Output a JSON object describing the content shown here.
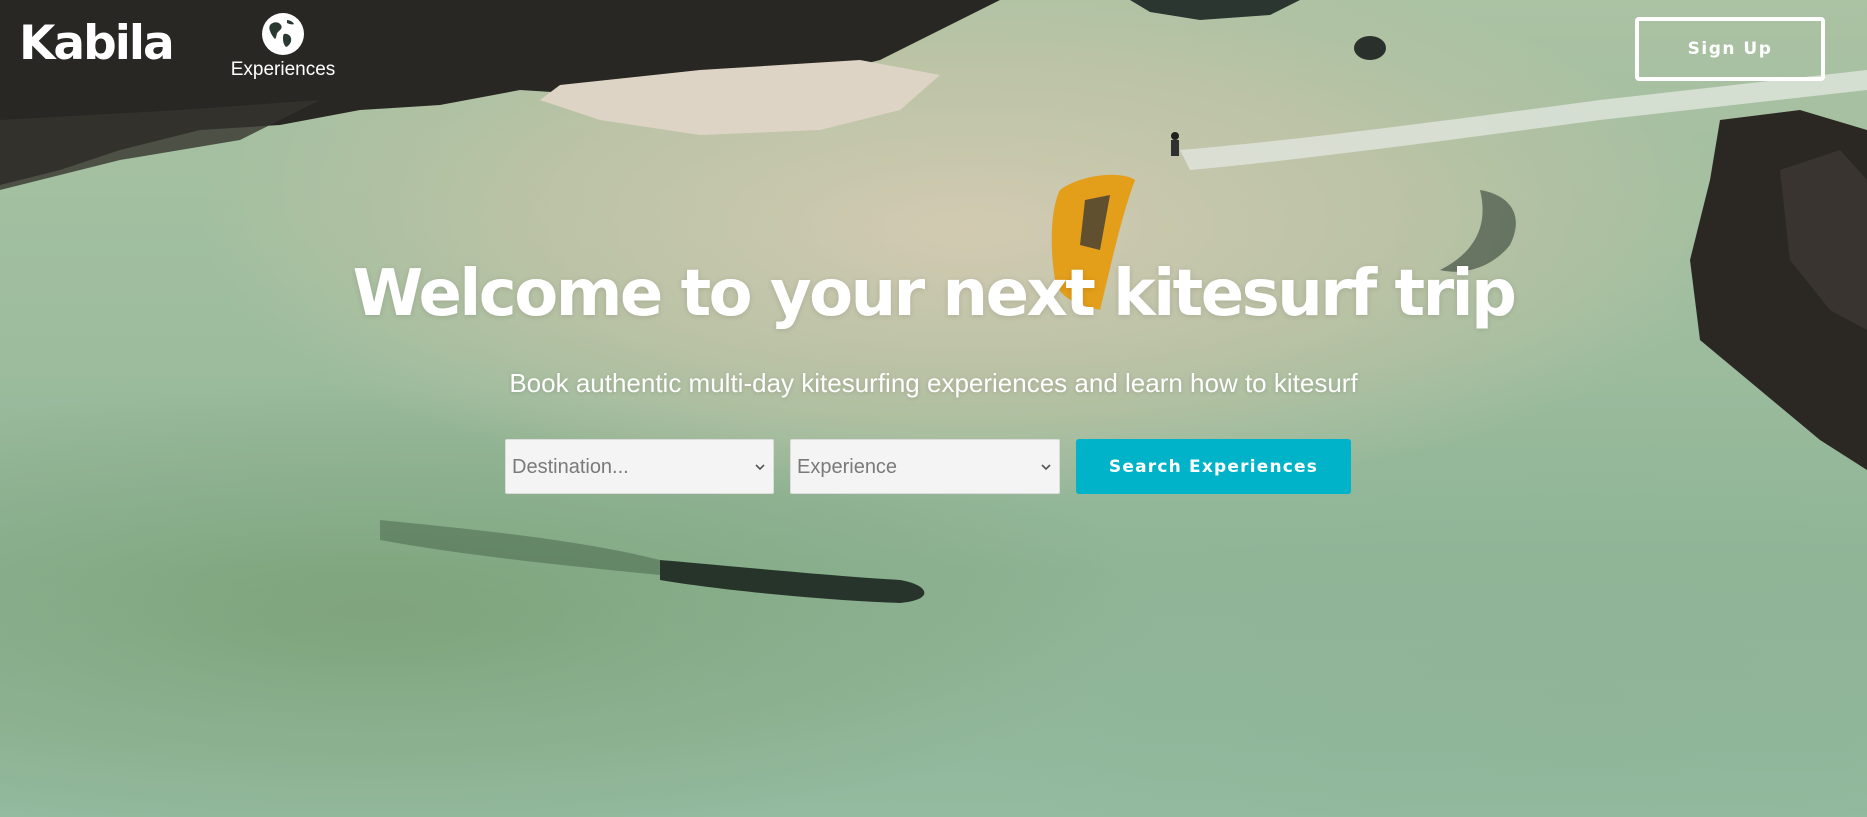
{
  "header": {
    "logo_text": "Kabila",
    "nav_experiences_label": "Experiences",
    "nav_experiences_icon": "globe-icon",
    "signup_label": "Sign Up"
  },
  "hero": {
    "headline": "Welcome to your next kitesurf trip",
    "subheadline": "Book authentic multi-day kitesurfing experiences and learn how to kitesurf"
  },
  "search": {
    "destination_value": "Destination...",
    "experience_value": "Experience",
    "submit_label": "Search Experiences"
  },
  "colors": {
    "accent": "#00b3c9",
    "text_on_image": "#ffffff",
    "select_background": "#f4f4f4"
  }
}
